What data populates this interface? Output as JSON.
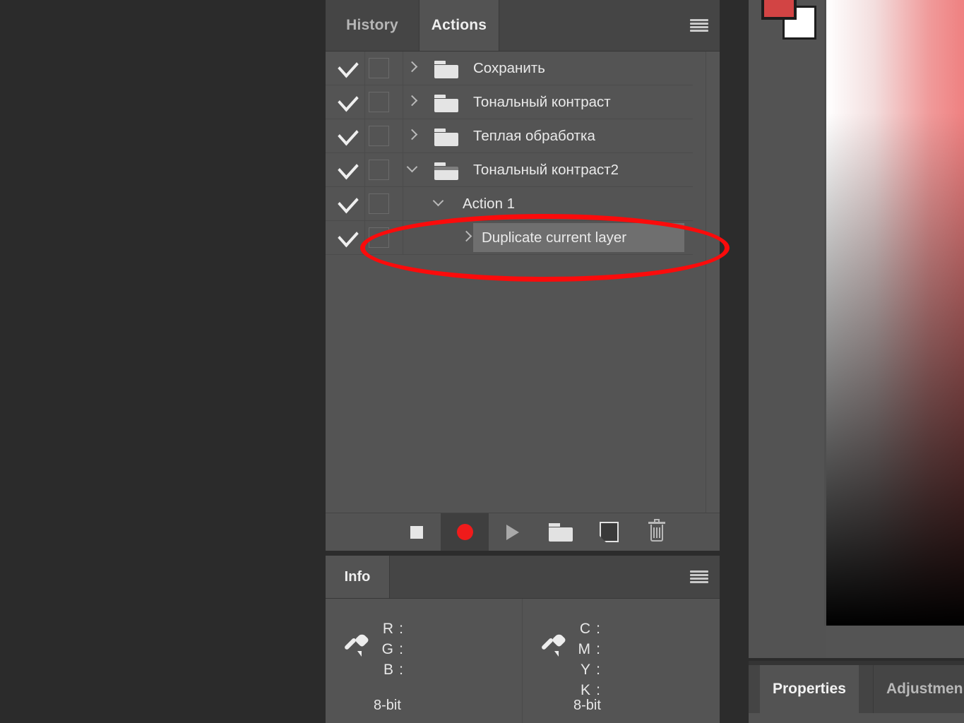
{
  "workspace": {
    "background_color": "#2b2b2b"
  },
  "actions_panel": {
    "tabs": [
      {
        "label": "History",
        "active": false
      },
      {
        "label": "Actions",
        "active": true
      }
    ],
    "menu_icon": "hamburger-menu-icon",
    "rows": [
      {
        "label": "Сохранить",
        "checked": true,
        "toggle": false,
        "disclosure": "chevron-right-icon",
        "icon": "folder-icon",
        "indent": 0,
        "selected": false
      },
      {
        "label": "Тональный контраст",
        "checked": true,
        "toggle": false,
        "disclosure": "chevron-right-icon",
        "icon": "folder-icon",
        "indent": 0,
        "selected": false
      },
      {
        "label": "Теплая обработка",
        "checked": true,
        "toggle": false,
        "disclosure": "chevron-right-icon",
        "icon": "folder-icon",
        "indent": 0,
        "selected": false
      },
      {
        "label": "Тональный контраст2",
        "checked": true,
        "toggle": false,
        "disclosure": "chevron-down-icon",
        "icon": "folder-open-icon",
        "indent": 0,
        "selected": false
      },
      {
        "label": "Action 1",
        "checked": true,
        "toggle": false,
        "disclosure": "chevron-down-icon",
        "icon": "none",
        "indent": 1,
        "selected": false
      },
      {
        "label": "Duplicate current layer",
        "checked": true,
        "toggle": false,
        "disclosure": "chevron-right-icon",
        "icon": "none",
        "indent": 2,
        "selected": true
      }
    ],
    "toolbar": [
      {
        "name": "stop-button",
        "icon": "stop-square-icon",
        "pressed": false
      },
      {
        "name": "record-button",
        "icon": "record-circle-icon",
        "pressed": true
      },
      {
        "name": "play-button",
        "icon": "play-triangle-icon",
        "pressed": false
      },
      {
        "name": "new-set-button",
        "icon": "folder-icon",
        "pressed": false
      },
      {
        "name": "new-action-button",
        "icon": "new-document-icon",
        "pressed": false
      },
      {
        "name": "delete-button",
        "icon": "trash-icon",
        "pressed": false
      }
    ]
  },
  "annotation": {
    "shape": "ellipse",
    "color": "#fb0b0b",
    "target_row_label": "Duplicate current layer"
  },
  "info_panel": {
    "tab_label": "Info",
    "menu_icon": "hamburger-menu-icon",
    "readouts": [
      {
        "icon": "eyedropper-icon",
        "channels": [
          {
            "name": "R",
            "colon": ":",
            "value": ""
          },
          {
            "name": "G",
            "colon": ":",
            "value": ""
          },
          {
            "name": "B",
            "colon": ":",
            "value": ""
          }
        ],
        "bit_depth": "8-bit"
      },
      {
        "icon": "eyedropper-icon",
        "channels": [
          {
            "name": "C",
            "colon": ":",
            "value": ""
          },
          {
            "name": "M",
            "colon": ":",
            "value": ""
          },
          {
            "name": "Y",
            "colon": ":",
            "value": ""
          },
          {
            "name": "K",
            "colon": ":",
            "value": ""
          }
        ],
        "bit_depth": "8-bit"
      }
    ]
  },
  "right_column": {
    "foreground_color": "#d24444",
    "background_color": "#ffffff",
    "color_field": "color-picker-gradient",
    "tabs": [
      {
        "label": "Properties",
        "active": true
      },
      {
        "label": "Adjustmen",
        "active": false
      }
    ]
  }
}
